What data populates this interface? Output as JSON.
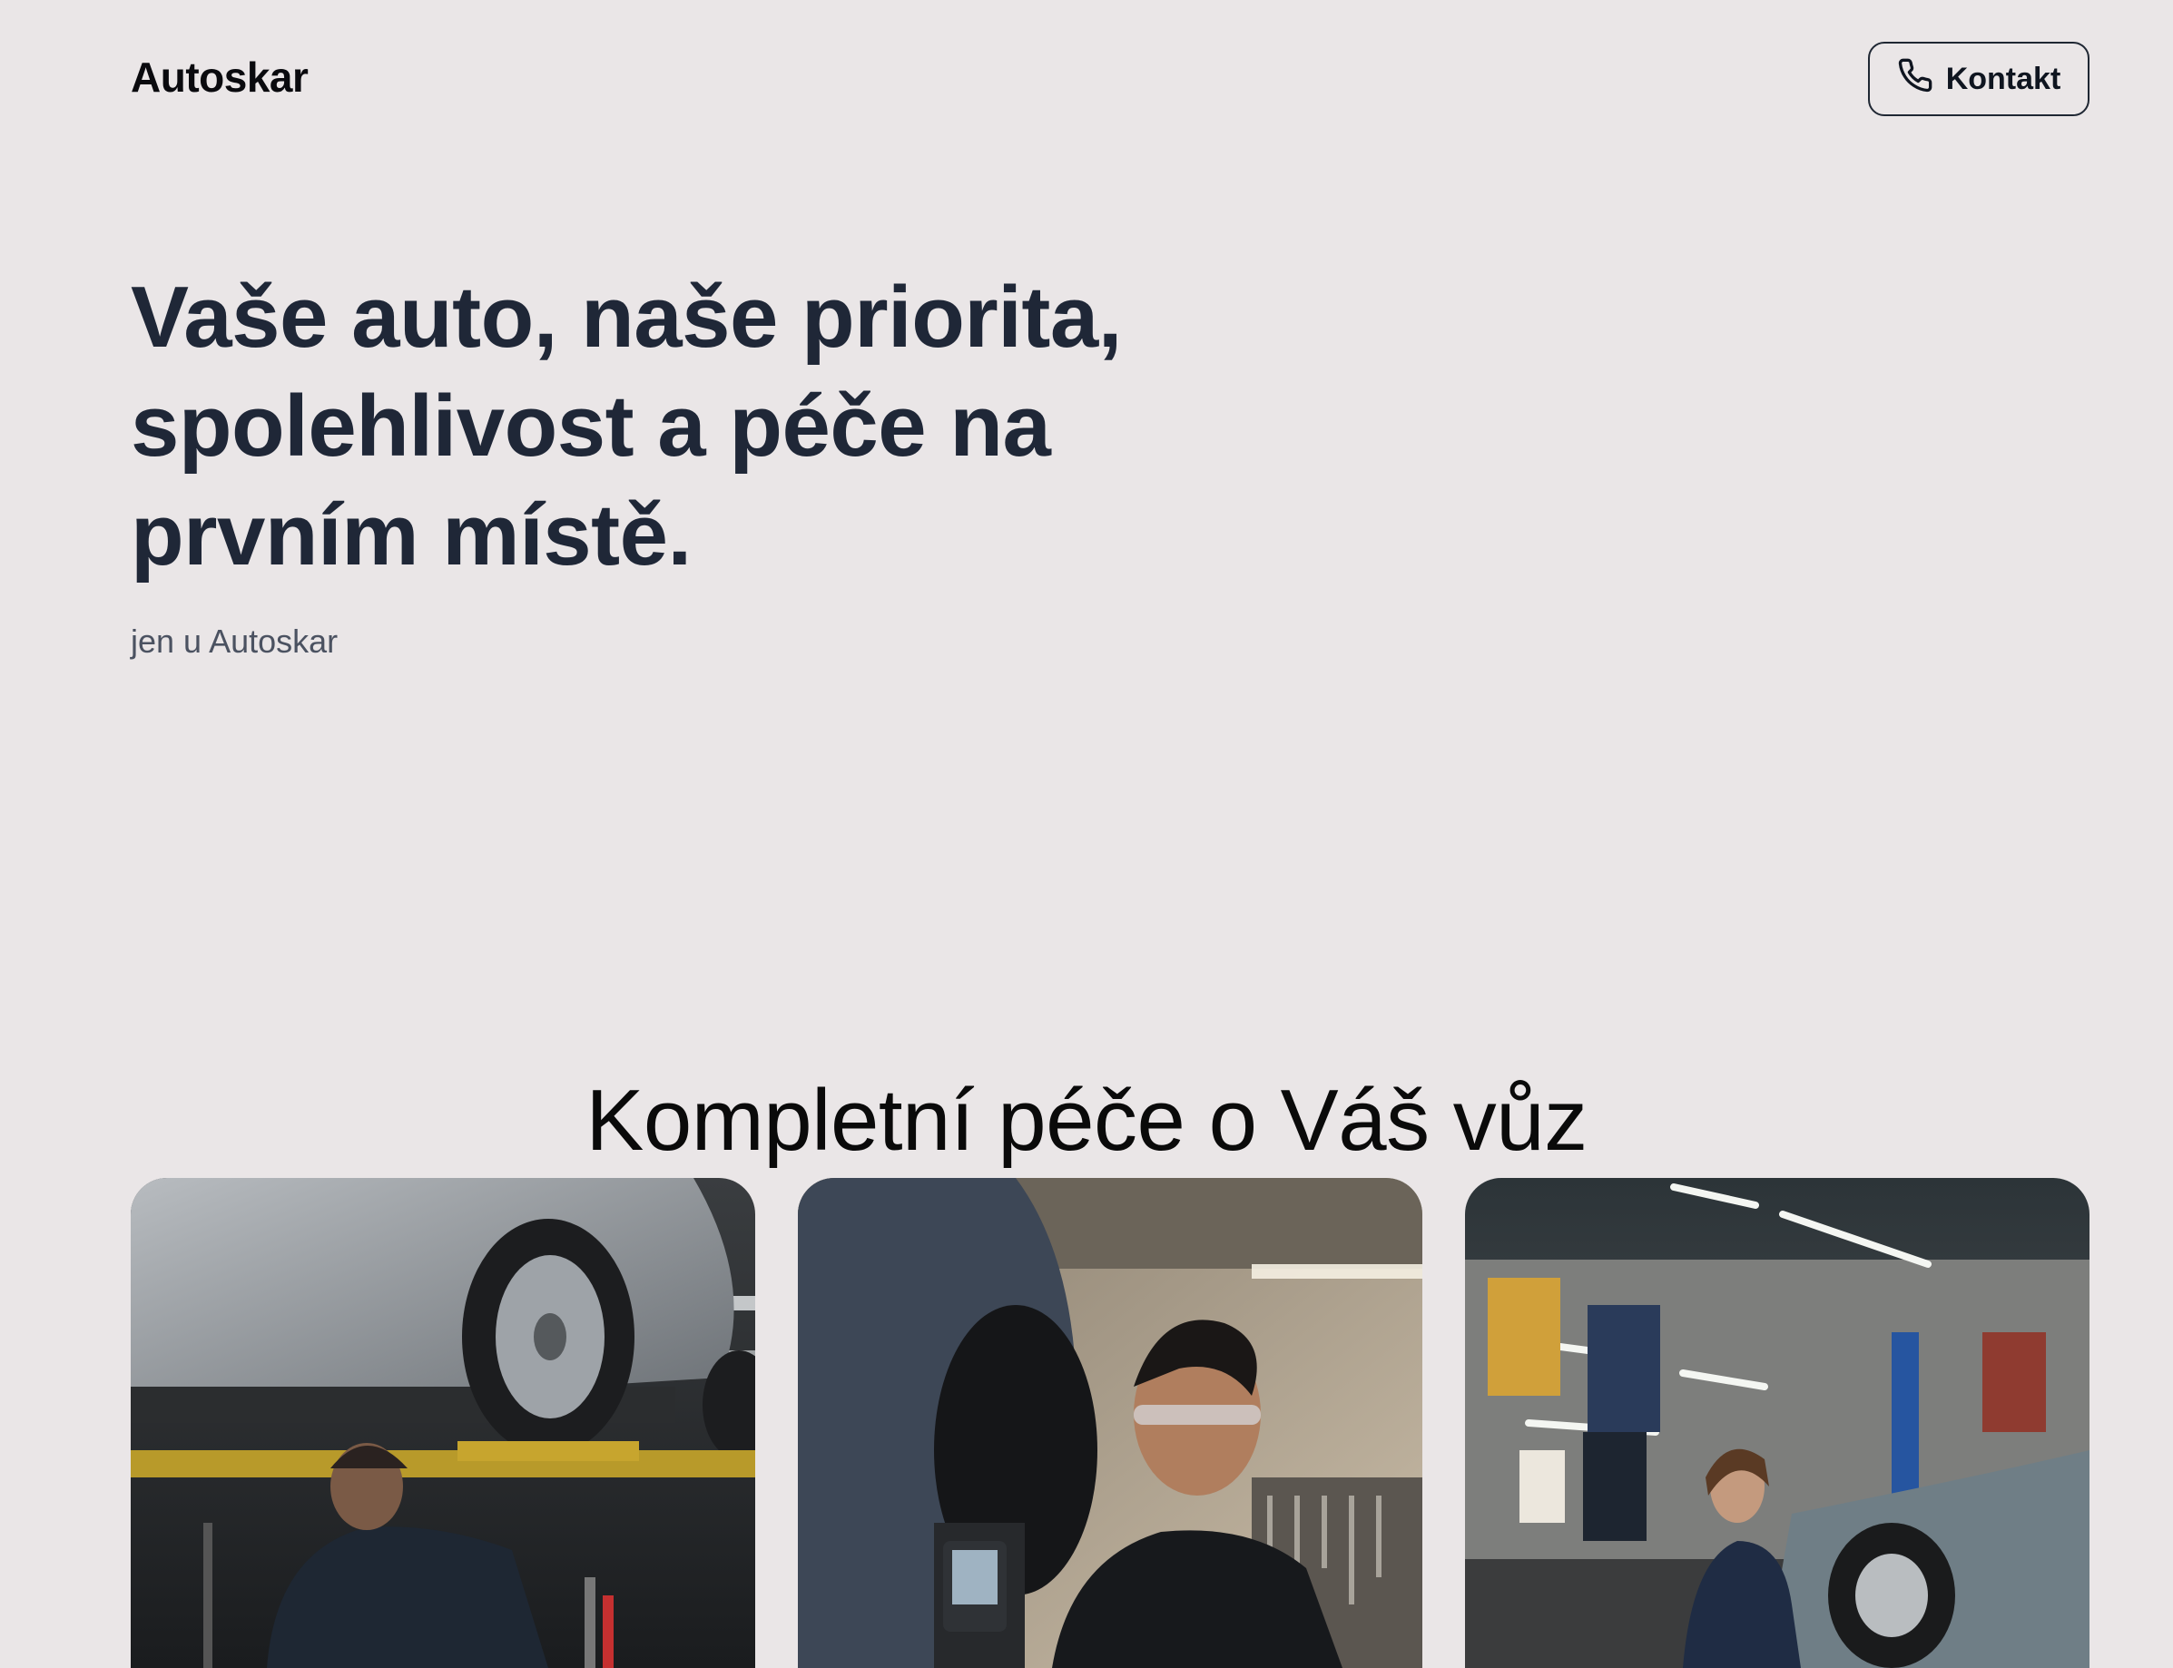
{
  "header": {
    "brand": "Autoskar",
    "contact_label": "Kontakt"
  },
  "hero": {
    "title": "Vaše auto, naše priorita, spolehlivost a péče na prvním místě.",
    "subtitle": "jen u Autoskar"
  },
  "services": {
    "title": "Kompletní péče o Váš vůz",
    "cards": [
      {
        "image": "mechanic-under-lifted-car-photo"
      },
      {
        "image": "mechanic-with-diagnostic-tool-photo"
      },
      {
        "image": "mechanic-in-garage-with-classic-car-photo"
      }
    ]
  },
  "colors": {
    "background": "#eae6e7",
    "heading": "#1f2737",
    "text": "#0a0a0e",
    "muted": "#4b5261"
  }
}
